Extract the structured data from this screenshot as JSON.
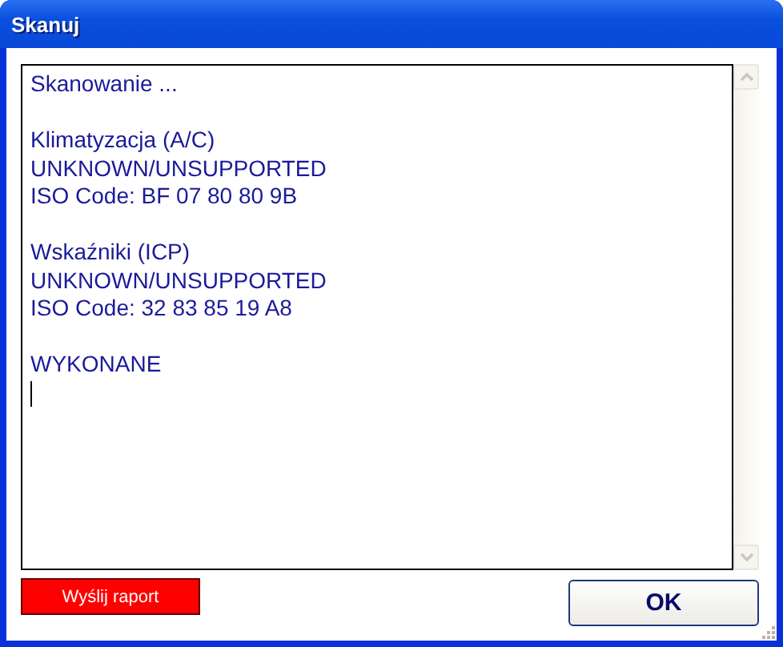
{
  "window": {
    "title": "Skanuj"
  },
  "log": {
    "blocks": [
      [
        "Skanowanie ..."
      ],
      [
        "Klimatyzacja (A/C)",
        "UNKNOWN/UNSUPPORTED",
        "ISO Code: BF 07 80 80 9B"
      ],
      [
        "Wskaźniki (ICP)",
        "UNKNOWN/UNSUPPORTED",
        "ISO Code: 32 83 85 19 A8"
      ],
      [
        "WYKONANE"
      ]
    ]
  },
  "buttons": [
    {
      "kind": "report",
      "label": "Wyślij raport"
    },
    {
      "kind": "ok",
      "label": "OK"
    }
  ]
}
